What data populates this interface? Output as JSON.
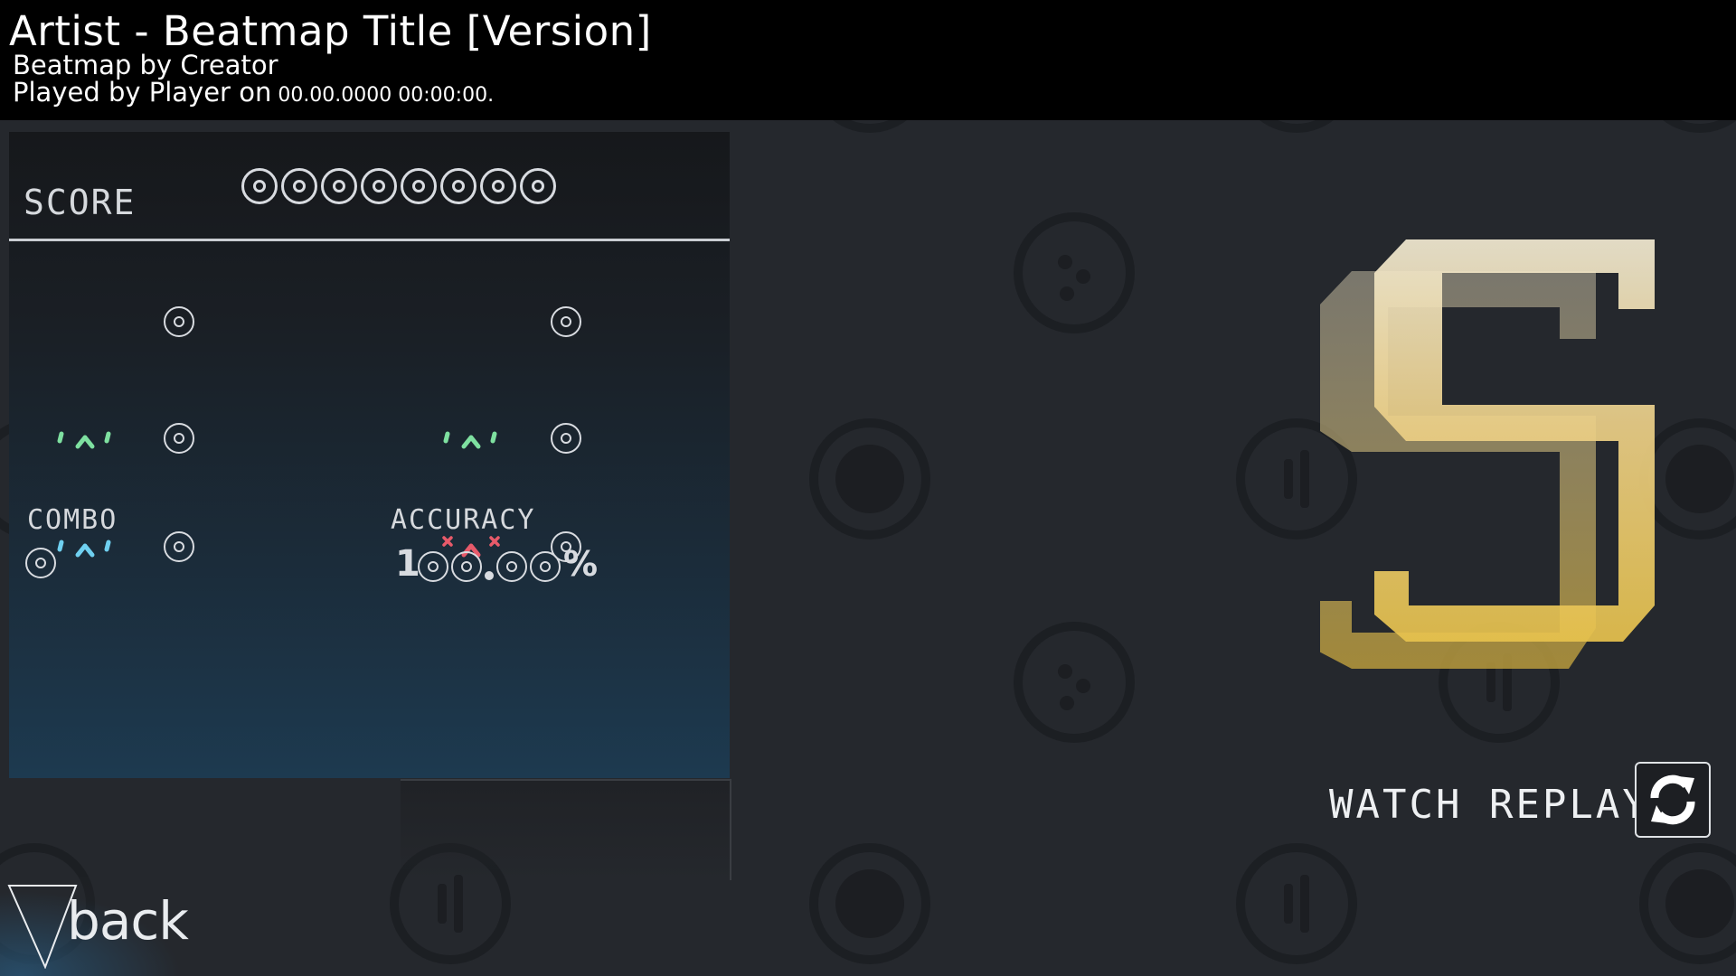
{
  "header": {
    "title": "Artist - Beatmap Title [Version]",
    "creator": "Beatmap by Creator",
    "played_prefix": "Played by Player on",
    "played_date": " 00.00.0000 00:00:00."
  },
  "scoreboard": {
    "score_label": "SCORE",
    "score_value": "00000000",
    "combo_label": "COMBO",
    "combo_value": "0",
    "accuracy_label": "ACCURACY",
    "accuracy_value": "100.00%",
    "hits": [
      {
        "name": "hit-300",
        "count": "0",
        "icon": "none"
      },
      {
        "name": "hit-geki",
        "count": "0",
        "icon": "none"
      },
      {
        "name": "hit-100",
        "count": "0",
        "icon": "happy-face-green-icon"
      },
      {
        "name": "hit-katu",
        "count": "0",
        "icon": "happy-face-green-icon"
      },
      {
        "name": "hit-50",
        "count": "0",
        "icon": "happy-face-blue-icon"
      },
      {
        "name": "hit-miss",
        "count": "0",
        "icon": "miss-face-red-icon"
      }
    ]
  },
  "rank": {
    "grade": "S",
    "color": "#e6c55a"
  },
  "actions": {
    "watch_replay_label": "WATCH REPLAY",
    "back_label": "back"
  },
  "colors": {
    "header_bg": "#000000",
    "background": "#25282d",
    "hit_green": "#7ee0a0",
    "hit_blue": "#6fd0f0",
    "hit_red": "#e85a6a"
  }
}
